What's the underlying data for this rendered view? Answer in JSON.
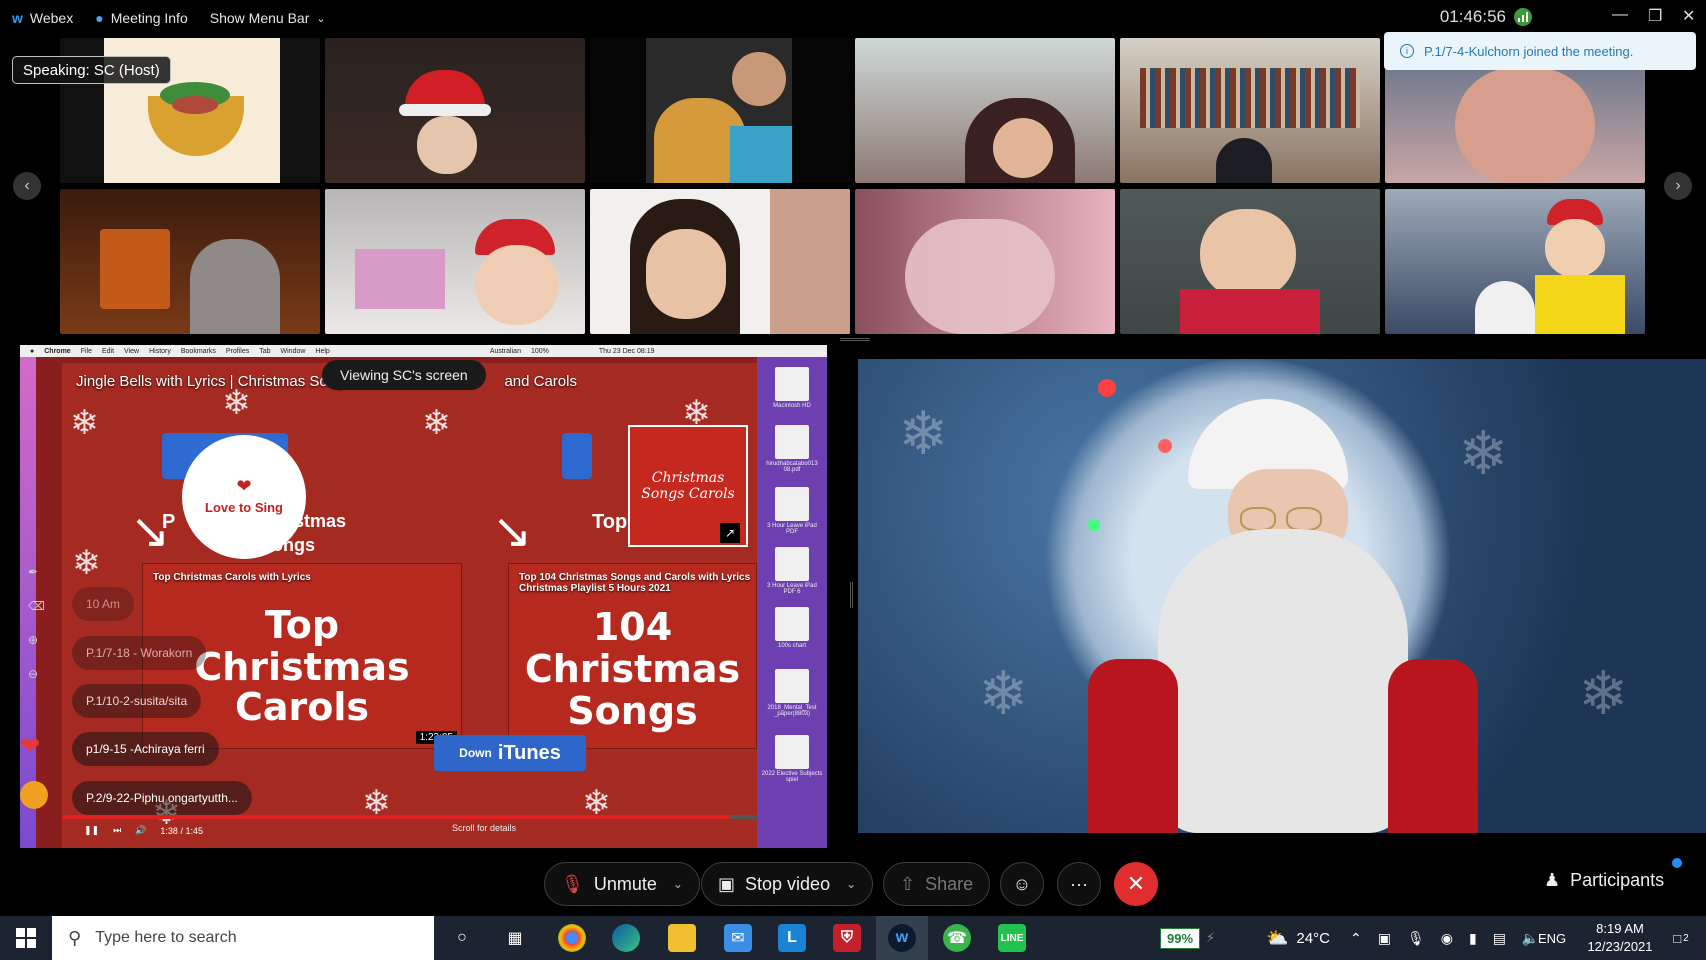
{
  "titlebar": {
    "app": "Webex",
    "meeting_info": "Meeting Info",
    "menu": "Show Menu Bar",
    "clock": "01:46:56"
  },
  "toast": "P.1/7-4-Kulchorn joined the meeting.",
  "speaking": "Speaking: SC (Host)",
  "shared_screen": {
    "mac_menu": [
      "Chrome",
      "File",
      "Edit",
      "View",
      "History",
      "Bookmarks",
      "Profiles",
      "Tab",
      "Window",
      "Help"
    ],
    "mac_clock": "Thu 23 Dec 08:19",
    "mac_battery": "100%",
    "mac_lang": "Australian",
    "video_title": "Jingle Bells with Lyrics | Christmas Song",
    "video_title_tail": "and Carols",
    "viewing_label": "Viewing SC's screen",
    "logo_text": "Love to Sing",
    "card1_title": "Top Christmas Carols with Lyrics",
    "card1_big": [
      "Top",
      "Christmas",
      "Carols"
    ],
    "card1_time": "1:23:05",
    "card2_title": "Top 104 Christmas Songs and Carols with Lyrics",
    "card2_sub": "Christmas Playlist 5 Hours 2021",
    "card2_big": [
      "104",
      "Christmas",
      "Songs"
    ],
    "card2_thumb": "Christmas Songs Carols",
    "itunes": "iTunes",
    "download": "Down",
    "top_fragment": "Top",
    "bg_fragment_1": "P",
    "bg_fragment_2": "ristmas",
    "bg_fragment_3": "ongs",
    "playtime": "1:38 / 1:45",
    "scroll_hint": "Scroll for details",
    "desktop_files": [
      "Macintosh HD",
      "hirudhabcatabo013 08.pdf",
      "3 Hour Leave iPad PDF",
      "3 Hour Leave iPad PDF 6",
      "100s chart",
      "2018_Mental_Test _paper(8803)",
      "2022 Elective Subjects spiel"
    ]
  },
  "chat": [
    {
      "name": "10 Am"
    },
    {
      "name": "P.1/7-18 - Worakorn"
    },
    {
      "name": "P.1/10-2-susita/sita"
    },
    {
      "name": "p1/9-15 -Achiraya ferri"
    },
    {
      "name": "P.2/9-22-Piphu ongartyutth..."
    }
  ],
  "controls": {
    "unmute": "Unmute",
    "stop_video": "Stop video",
    "share": "Share",
    "more": "···",
    "participants": "Participants"
  },
  "taskbar": {
    "search_placeholder": "Type here to search",
    "battery": "99%",
    "temperature": "24°C",
    "lang": "ENG",
    "time": "8:19 AM",
    "date": "12/23/2021",
    "notif_count": "2"
  },
  "colors": {
    "end_call": "#e02d2d",
    "toast_text": "#2779b3",
    "share_bg": "#a52a22"
  }
}
